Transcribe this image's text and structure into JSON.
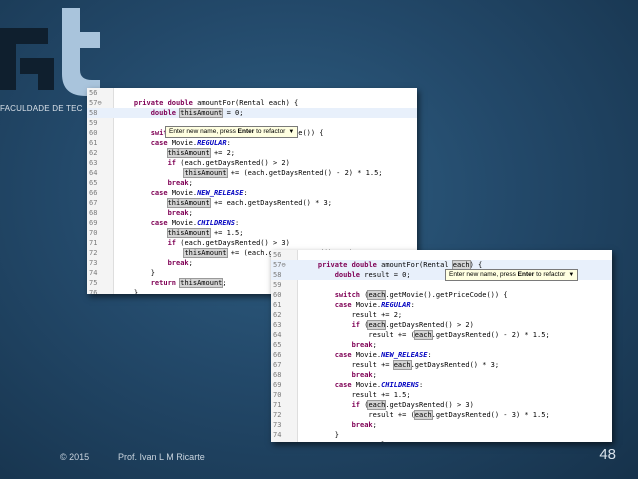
{
  "logo": {
    "brand_text": "FACULDADE DE TEC"
  },
  "footer": {
    "copyright": "© 2015",
    "author": "Prof. Ivan L M Ricarte",
    "page_number": "48"
  },
  "editor1": {
    "rename_tip": {
      "prefix": "Enter new name, press ",
      "key": "Enter",
      "suffix": " to refactor",
      "arrow": "▼"
    },
    "lines": [
      {
        "num": "56",
        "text": ""
      },
      {
        "num": "57⊖",
        "text": "    private double amountFor(Rental each) {"
      },
      {
        "num": "58",
        "text": "        double thisAmount = 0;"
      },
      {
        "num": "59",
        "text": ""
      },
      {
        "num": "60",
        "text": "        switch (each.getMovie().getPriceCode()) {"
      },
      {
        "num": "61",
        "text": "        case Movie.REGULAR:"
      },
      {
        "num": "62",
        "text": "            thisAmount += 2;"
      },
      {
        "num": "63",
        "text": "            if (each.getDaysRented() > 2)"
      },
      {
        "num": "64",
        "text": "                thisAmount += (each.getDaysRented() - 2) * 1.5;"
      },
      {
        "num": "65",
        "text": "            break;"
      },
      {
        "num": "66",
        "text": "        case Movie.NEW_RELEASE:"
      },
      {
        "num": "67",
        "text": "            thisAmount += each.getDaysRented() * 3;"
      },
      {
        "num": "68",
        "text": "            break;"
      },
      {
        "num": "69",
        "text": "        case Movie.CHILDRENS:"
      },
      {
        "num": "70",
        "text": "            thisAmount += 1.5;"
      },
      {
        "num": "71",
        "text": "            if (each.getDaysRented() > 3)"
      },
      {
        "num": "72",
        "text": "                thisAmount += (each.getDaysRented() - 3) * 1.5;"
      },
      {
        "num": "73",
        "text": "            break;"
      },
      {
        "num": "74",
        "text": "        }"
      },
      {
        "num": "75",
        "text": "        return thisAmount;"
      },
      {
        "num": "76",
        "text": "    }"
      }
    ]
  },
  "editor2": {
    "rename_tip": {
      "prefix": "Enter new name, press ",
      "key": "Enter",
      "suffix": " to refactor",
      "arrow": "▼"
    },
    "lines": [
      {
        "num": "56",
        "text": ""
      },
      {
        "num": "57⊖",
        "text": "    private double amountFor(Rental each) {"
      },
      {
        "num": "58",
        "text": "        double result = 0;"
      },
      {
        "num": "59",
        "text": ""
      },
      {
        "num": "60",
        "text": "        switch (each.getMovie().getPriceCode()) {"
      },
      {
        "num": "61",
        "text": "        case Movie.REGULAR:"
      },
      {
        "num": "62",
        "text": "            result += 2;"
      },
      {
        "num": "63",
        "text": "            if (each.getDaysRented() > 2)"
      },
      {
        "num": "64",
        "text": "                result += (each.getDaysRented() - 2) * 1.5;"
      },
      {
        "num": "65",
        "text": "            break;"
      },
      {
        "num": "66",
        "text": "        case Movie.NEW_RELEASE:"
      },
      {
        "num": "67",
        "text": "            result += each.getDaysRented() * 3;"
      },
      {
        "num": "68",
        "text": "            break;"
      },
      {
        "num": "69",
        "text": "        case Movie.CHILDRENS:"
      },
      {
        "num": "70",
        "text": "            result += 1.5;"
      },
      {
        "num": "71",
        "text": "            if (each.getDaysRented() > 3)"
      },
      {
        "num": "72",
        "text": "                result += (each.getDaysRented() - 3) * 1.5;"
      },
      {
        "num": "73",
        "text": "            break;"
      },
      {
        "num": "74",
        "text": "        }"
      },
      {
        "num": "75",
        "text": "        return result;"
      },
      {
        "num": "76",
        "text": "    }"
      }
    ]
  }
}
